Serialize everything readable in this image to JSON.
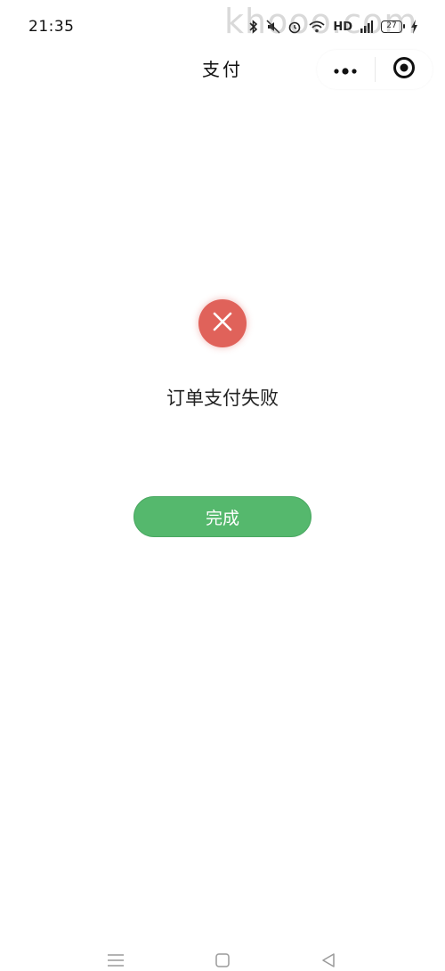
{
  "status_bar": {
    "time": "21:35",
    "network_label": "HD",
    "battery_level": "27"
  },
  "watermark": "khooo.com",
  "nav": {
    "title": "支付"
  },
  "result": {
    "message": "订单支付失败",
    "status_color": "#e0625a"
  },
  "actions": {
    "done_label": "完成",
    "button_color": "#55b86d"
  },
  "icons": {
    "more": "more-dots-icon",
    "close_miniapp": "target-circle-icon",
    "result": "x-close-icon",
    "sys_menu": "menu-lines-icon",
    "sys_home": "square-icon",
    "sys_back": "back-triangle-icon"
  }
}
